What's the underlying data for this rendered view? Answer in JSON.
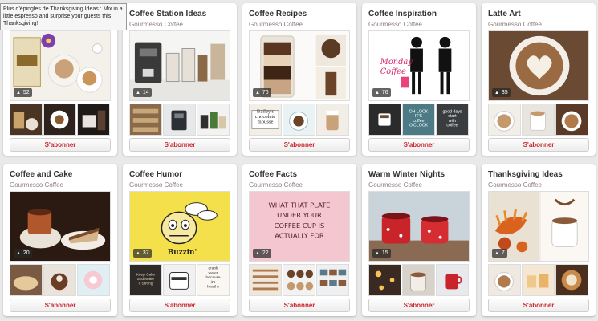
{
  "tooltip": "Plus d'épingles de Thanksgiving Ideas : Mix in a little espresso and surprise your guests this Thanksgiving!",
  "follow_label": "S'abonner",
  "accent_color": "#c8232c",
  "boards": [
    {
      "title": "",
      "owner": "",
      "pin_count": "52"
    },
    {
      "title": "Coffee Station Ideas",
      "owner": "Gourmesso Coffee",
      "pin_count": "14"
    },
    {
      "title": "Coffee Recipes",
      "owner": "Gourmesso Coffee",
      "pin_count": "76"
    },
    {
      "title": "Coffee Inspiration",
      "owner": "Gourmesso Coffee",
      "pin_count": "76"
    },
    {
      "title": "Latte Art",
      "owner": "Gourmesso Coffee",
      "pin_count": "35"
    },
    {
      "title": "Coffee and Cake",
      "owner": "Gourmesso Coffee",
      "pin_count": "20"
    },
    {
      "title": "Coffee Humor",
      "owner": "Gourmesso Coffee",
      "pin_count": "37"
    },
    {
      "title": "Coffee Facts",
      "owner": "Gourmesso Coffee",
      "pin_count": "22"
    },
    {
      "title": "Warm Winter Nights",
      "owner": "Gourmesso Coffee",
      "pin_count": "15"
    },
    {
      "title": "Thanksgiving Ideas",
      "owner": "Gourmesso Coffee",
      "pin_count": "7"
    }
  ],
  "image_text": {
    "inspiration_script": "Monday Coffee",
    "humor_caption": "Buzzin'",
    "facts_text": "WHAT THAT PLATE UNDER YOUR COFFEE CUP IS ACTUALLY FOR",
    "recipes_thumb": "Bailey's chocolate mousse",
    "inspiration_thumb_1": "OH LOOK IT'S coffee O'CLOCK",
    "inspiration_thumb_2": "good days start with coffee",
    "humor_thumb_1": "Keep Calm and Make It Strong",
    "humor_thumb_2": "drank water because it's healthy"
  }
}
